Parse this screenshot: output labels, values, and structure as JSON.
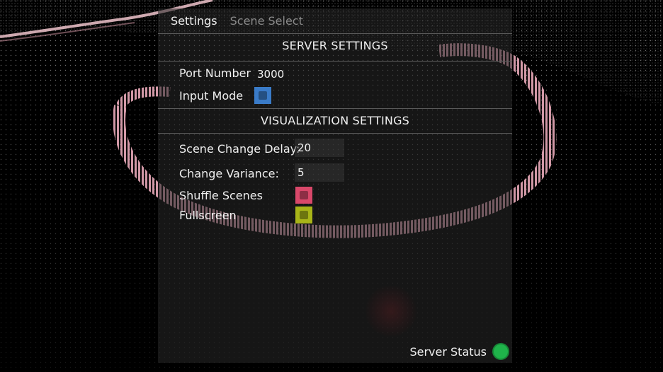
{
  "tabs": [
    {
      "label": "Settings"
    },
    {
      "label": "Scene Select"
    }
  ],
  "server_settings": {
    "header": "SERVER SETTINGS",
    "port_label": "Port Number",
    "port_value": "3000",
    "input_mode_label": "Input Mode"
  },
  "visualization_settings": {
    "header": "VISUALIZATION SETTINGS",
    "scene_change_delay_label": "Scene Change Delay:",
    "scene_change_delay_value": "20",
    "change_variance_label": "Change Variance:",
    "change_variance_value": "5",
    "shuffle_scenes_label": "Shuffle Scenes",
    "fullscreen_label": "Fullscreen"
  },
  "status": {
    "label": "Server Status"
  },
  "colors": {
    "input_mode_toggle": "#3a7bc8",
    "shuffle_toggle": "#d9486a",
    "fullscreen_toggle": "#a8b418",
    "server_status_ok": "#1fb34a",
    "particle_ring": "#e8a9b8"
  },
  "icons": {
    "status": "status-indicator-dot"
  }
}
